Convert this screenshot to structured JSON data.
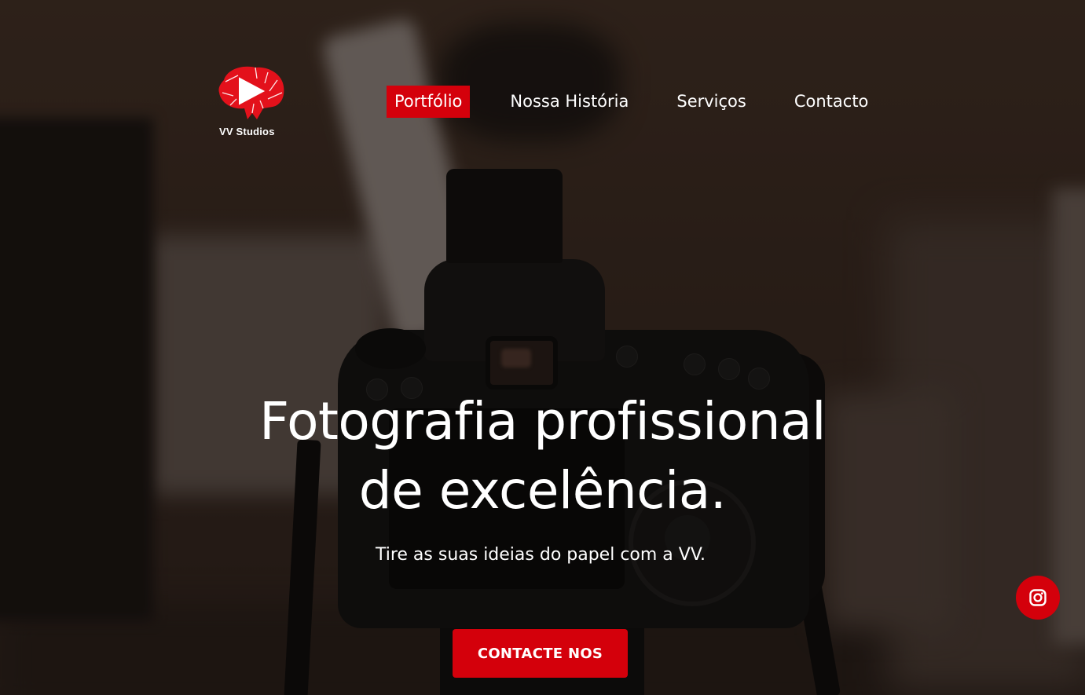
{
  "brand": {
    "name": "VV Studios",
    "logo_icon": "brain-play-logo",
    "accent_color": "#d4000b"
  },
  "nav": {
    "items": [
      {
        "label": "Portfólio",
        "active": true
      },
      {
        "label": "Nossa História",
        "active": false
      },
      {
        "label": "Serviços",
        "active": false
      },
      {
        "label": "Contacto",
        "active": false
      }
    ]
  },
  "hero": {
    "headline_line1": "Fotografia profissional",
    "headline_line2": "de excelência.",
    "subtitle": "Tire as suas ideias do papel com a VV.",
    "cta_label": "CONTACTE NOS"
  },
  "floating": {
    "instagram_icon": "instagram-icon"
  }
}
